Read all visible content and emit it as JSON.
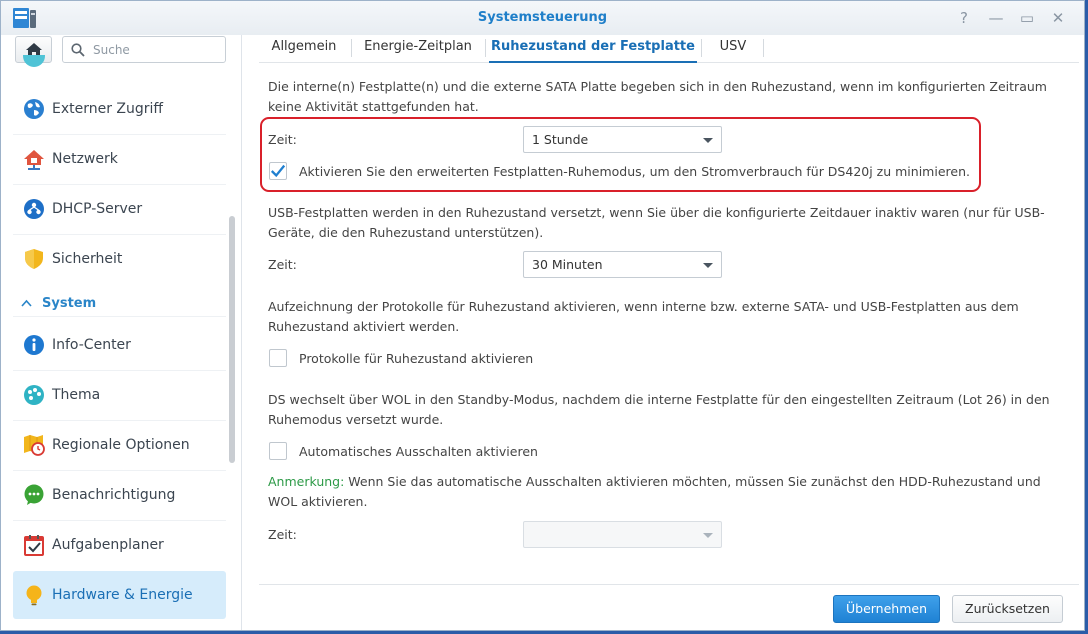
{
  "window": {
    "title": "Systemsteuerung",
    "controls": {
      "help": "?",
      "minimize": "—",
      "maximize": "▭",
      "close": "✕"
    }
  },
  "sidebar": {
    "search_placeholder": "Suche",
    "items_top": [
      {
        "label": "Externer Zugriff",
        "icon": "globe-icon",
        "color": "#2a7fd0"
      },
      {
        "label": "Netzwerk",
        "icon": "house-network-icon",
        "color": "#e0553f"
      },
      {
        "label": "DHCP-Server",
        "icon": "dhcp-icon",
        "color": "#1e6fc7"
      },
      {
        "label": "Sicherheit",
        "icon": "shield-icon",
        "color": "#f2b61c"
      }
    ],
    "section": {
      "label": "System",
      "icon": "chevron-up-icon"
    },
    "items_system": [
      {
        "label": "Info-Center",
        "icon": "info-icon",
        "color": "#1e78d0"
      },
      {
        "label": "Thema",
        "icon": "palette-icon",
        "color": "#2fb3c4"
      },
      {
        "label": "Regionale Optionen",
        "icon": "map-clock-icon",
        "color": "#f2b61c"
      },
      {
        "label": "Benachrichtigung",
        "icon": "chat-bubble-icon",
        "color": "#3aa335"
      },
      {
        "label": "Aufgabenplaner",
        "icon": "calendar-check-icon",
        "color": "#d93a34"
      },
      {
        "label": "Hardware & Energie",
        "icon": "lightbulb-icon",
        "color": "#f5b41a",
        "active": true
      }
    ]
  },
  "tabs": [
    {
      "label": "Allgemein"
    },
    {
      "label": "Energie-Zeitplan"
    },
    {
      "label": "Ruhezustand der Festplatte",
      "active": true
    },
    {
      "label": "USV"
    }
  ],
  "content": {
    "intro": "Die interne(n) Festplatte(n) und die externe SATA Platte begeben sich in den Ruhezustand, wenn im konfigurierten Zeitraum keine Aktivität stattgefunden hat.",
    "time_label_1": "Zeit:",
    "time_value_1": "1 Stunde",
    "advanced_mode_label": "Aktivieren Sie den erweiterten Festplatten-Ruhemodus, um den Stromverbrauch für DS420j zu minimieren.",
    "advanced_mode_checked": true,
    "usb_text": "USB-Festplatten werden in den Ruhezustand versetzt, wenn Sie über die konfigurierte Zeitdauer inaktiv waren (nur für USB-Geräte, die den Ruhezustand unterstützen).",
    "time_label_2": "Zeit:",
    "time_value_2": "30 Minuten",
    "log_text": "Aufzeichnung der Protokolle für Ruhezustand aktivieren, wenn interne bzw. externe SATA- und USB-Festplatten aus dem Ruhezustand aktiviert werden.",
    "log_checkbox_label": "Protokolle für Ruhezustand aktivieren",
    "log_checked": false,
    "wol_text": "DS wechselt über WOL in den Standby-Modus, nachdem die interne Festplatte für den eingestellten Zeitraum (Lot 26) in den Ruhemodus versetzt wurde.",
    "auto_shutdown_label": "Automatisches Ausschalten aktivieren",
    "auto_shutdown_checked": false,
    "note_label": "Anmerkung:",
    "note_text": " Wenn Sie das automatische Ausschalten aktivieren möchten, müssen Sie zunächst den HDD-Ruhezustand und WOL aktivieren.",
    "time_label_3": "Zeit:",
    "time_value_3": ""
  },
  "footer": {
    "apply_label": "Übernehmen",
    "reset_label": "Zurücksetzen"
  },
  "colors": {
    "accent": "#1a6fb5",
    "highlight_border": "#d9202a",
    "note_green": "#2d9a47",
    "active_nav_bg": "#d6ecfb"
  }
}
